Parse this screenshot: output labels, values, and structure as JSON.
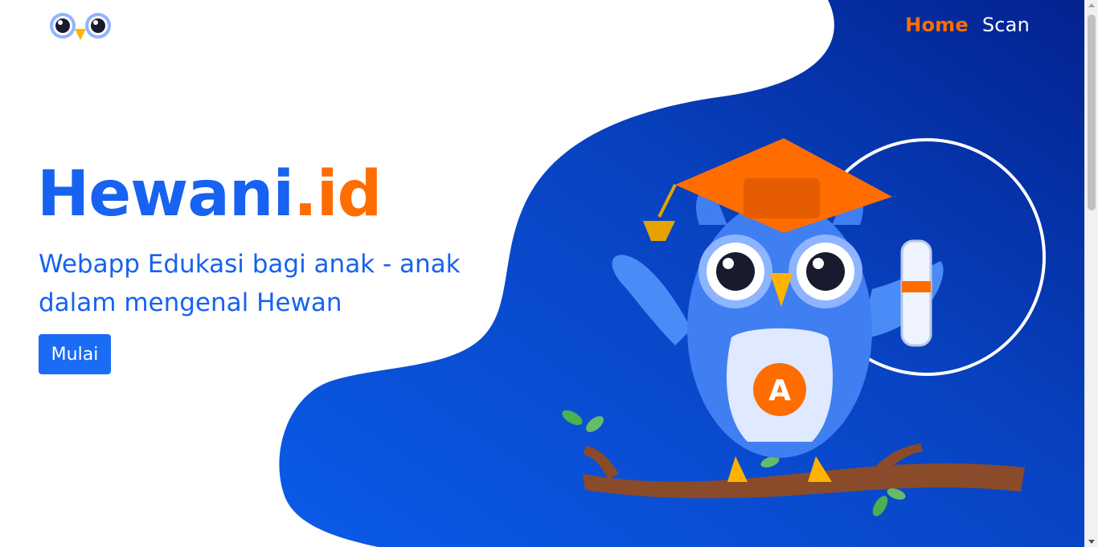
{
  "nav": {
    "logo_icon": "owl-eyes-icon",
    "home_label": "Home",
    "scan_label": "Scan"
  },
  "hero": {
    "title_main": "Hewani",
    "title_accent": ".id",
    "subtitle": "Webapp Edukasi bagi anak - anak dalam mengenal Hewan",
    "cta_label": "Mulai"
  },
  "illustration": {
    "name": "graduate-owl-on-branch",
    "badge_letter": "A"
  },
  "colors": {
    "primary_blue": "#1762f0",
    "accent_orange": "#ff6d00",
    "dark_blue": "#052a8f",
    "white": "#ffffff"
  }
}
